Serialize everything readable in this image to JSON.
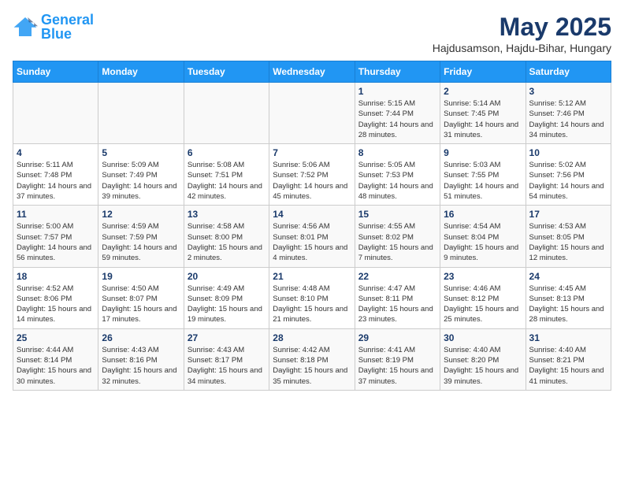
{
  "logo": {
    "text_general": "General",
    "text_blue": "Blue"
  },
  "title": "May 2025",
  "subtitle": "Hajdusamson, Hajdu-Bihar, Hungary",
  "weekdays": [
    "Sunday",
    "Monday",
    "Tuesday",
    "Wednesday",
    "Thursday",
    "Friday",
    "Saturday"
  ],
  "weeks": [
    [
      {
        "day": "",
        "info": ""
      },
      {
        "day": "",
        "info": ""
      },
      {
        "day": "",
        "info": ""
      },
      {
        "day": "",
        "info": ""
      },
      {
        "day": "1",
        "info": "Sunrise: 5:15 AM\nSunset: 7:44 PM\nDaylight: 14 hours and 28 minutes."
      },
      {
        "day": "2",
        "info": "Sunrise: 5:14 AM\nSunset: 7:45 PM\nDaylight: 14 hours and 31 minutes."
      },
      {
        "day": "3",
        "info": "Sunrise: 5:12 AM\nSunset: 7:46 PM\nDaylight: 14 hours and 34 minutes."
      }
    ],
    [
      {
        "day": "4",
        "info": "Sunrise: 5:11 AM\nSunset: 7:48 PM\nDaylight: 14 hours and 37 minutes."
      },
      {
        "day": "5",
        "info": "Sunrise: 5:09 AM\nSunset: 7:49 PM\nDaylight: 14 hours and 39 minutes."
      },
      {
        "day": "6",
        "info": "Sunrise: 5:08 AM\nSunset: 7:51 PM\nDaylight: 14 hours and 42 minutes."
      },
      {
        "day": "7",
        "info": "Sunrise: 5:06 AM\nSunset: 7:52 PM\nDaylight: 14 hours and 45 minutes."
      },
      {
        "day": "8",
        "info": "Sunrise: 5:05 AM\nSunset: 7:53 PM\nDaylight: 14 hours and 48 minutes."
      },
      {
        "day": "9",
        "info": "Sunrise: 5:03 AM\nSunset: 7:55 PM\nDaylight: 14 hours and 51 minutes."
      },
      {
        "day": "10",
        "info": "Sunrise: 5:02 AM\nSunset: 7:56 PM\nDaylight: 14 hours and 54 minutes."
      }
    ],
    [
      {
        "day": "11",
        "info": "Sunrise: 5:00 AM\nSunset: 7:57 PM\nDaylight: 14 hours and 56 minutes."
      },
      {
        "day": "12",
        "info": "Sunrise: 4:59 AM\nSunset: 7:59 PM\nDaylight: 14 hours and 59 minutes."
      },
      {
        "day": "13",
        "info": "Sunrise: 4:58 AM\nSunset: 8:00 PM\nDaylight: 15 hours and 2 minutes."
      },
      {
        "day": "14",
        "info": "Sunrise: 4:56 AM\nSunset: 8:01 PM\nDaylight: 15 hours and 4 minutes."
      },
      {
        "day": "15",
        "info": "Sunrise: 4:55 AM\nSunset: 8:02 PM\nDaylight: 15 hours and 7 minutes."
      },
      {
        "day": "16",
        "info": "Sunrise: 4:54 AM\nSunset: 8:04 PM\nDaylight: 15 hours and 9 minutes."
      },
      {
        "day": "17",
        "info": "Sunrise: 4:53 AM\nSunset: 8:05 PM\nDaylight: 15 hours and 12 minutes."
      }
    ],
    [
      {
        "day": "18",
        "info": "Sunrise: 4:52 AM\nSunset: 8:06 PM\nDaylight: 15 hours and 14 minutes."
      },
      {
        "day": "19",
        "info": "Sunrise: 4:50 AM\nSunset: 8:07 PM\nDaylight: 15 hours and 17 minutes."
      },
      {
        "day": "20",
        "info": "Sunrise: 4:49 AM\nSunset: 8:09 PM\nDaylight: 15 hours and 19 minutes."
      },
      {
        "day": "21",
        "info": "Sunrise: 4:48 AM\nSunset: 8:10 PM\nDaylight: 15 hours and 21 minutes."
      },
      {
        "day": "22",
        "info": "Sunrise: 4:47 AM\nSunset: 8:11 PM\nDaylight: 15 hours and 23 minutes."
      },
      {
        "day": "23",
        "info": "Sunrise: 4:46 AM\nSunset: 8:12 PM\nDaylight: 15 hours and 25 minutes."
      },
      {
        "day": "24",
        "info": "Sunrise: 4:45 AM\nSunset: 8:13 PM\nDaylight: 15 hours and 28 minutes."
      }
    ],
    [
      {
        "day": "25",
        "info": "Sunrise: 4:44 AM\nSunset: 8:14 PM\nDaylight: 15 hours and 30 minutes."
      },
      {
        "day": "26",
        "info": "Sunrise: 4:43 AM\nSunset: 8:16 PM\nDaylight: 15 hours and 32 minutes."
      },
      {
        "day": "27",
        "info": "Sunrise: 4:43 AM\nSunset: 8:17 PM\nDaylight: 15 hours and 34 minutes."
      },
      {
        "day": "28",
        "info": "Sunrise: 4:42 AM\nSunset: 8:18 PM\nDaylight: 15 hours and 35 minutes."
      },
      {
        "day": "29",
        "info": "Sunrise: 4:41 AM\nSunset: 8:19 PM\nDaylight: 15 hours and 37 minutes."
      },
      {
        "day": "30",
        "info": "Sunrise: 4:40 AM\nSunset: 8:20 PM\nDaylight: 15 hours and 39 minutes."
      },
      {
        "day": "31",
        "info": "Sunrise: 4:40 AM\nSunset: 8:21 PM\nDaylight: 15 hours and 41 minutes."
      }
    ]
  ]
}
